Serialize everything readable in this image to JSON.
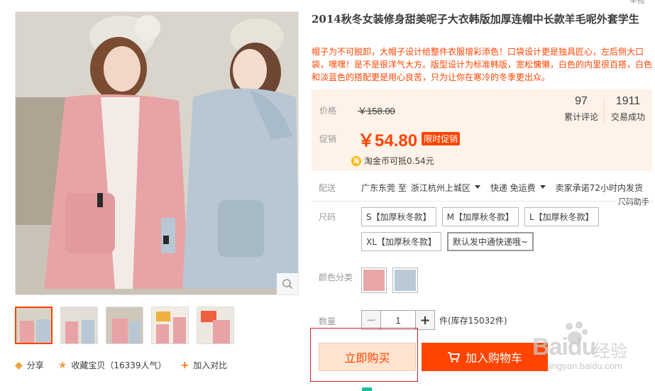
{
  "product": {
    "title": "2014秋冬女装修身甜美呢子大衣韩版加厚连帽中长款羊毛呢外套学生",
    "description": "帽子为不可脱卸，大帽子设计给整件衣服增彩添色！口袋设计更是独具匠心，左后侧大口袋，嘿嘿！是不是很洋气大方。版型设计为标准韩版，宽松慵懒，白色的内里很百搭，白色和淡蓝色的搭配更是用心良苦，只为让你在寒冷的冬季更出众。",
    "top_note": "举报"
  },
  "price": {
    "label_price": "价格",
    "original": "￥158.00",
    "label_promo": "促销",
    "current": "￥54.80",
    "promo_badge": "限时促销",
    "coin_icon": "淘",
    "coin_text": "淘金币可抵0.54元"
  },
  "stats": {
    "reviews_count": "97",
    "reviews_label": "累计评论",
    "sales_count": "1911",
    "sales_label": "交易成功"
  },
  "shipping": {
    "label": "配送",
    "from": "广东东莞 至",
    "to": "浙江杭州上城区",
    "method": "快递 免运费",
    "promise": "卖家承诺72小时内发货",
    "size_helper": "尺码助手"
  },
  "sizes": {
    "label": "尺码",
    "options": [
      "S【加厚秋冬款】",
      "M【加厚秋冬款】",
      "L【加厚秋冬款】",
      "XL【加厚秋冬款】",
      "默认发中通快递哦~"
    ]
  },
  "colors": {
    "label": "颜色分类",
    "swatches": [
      "#e8a6a6",
      "#b9c9d6"
    ]
  },
  "quantity": {
    "label": "数量",
    "minus": "−",
    "value": "1",
    "plus": "+",
    "stock": "件(库存15032件)"
  },
  "buttons": {
    "buy_now": "立即购买",
    "add_cart": "加入购物车"
  },
  "social": {
    "share": "分享",
    "favorite": "收藏宝贝（16339人气）",
    "compare": "加入对比"
  },
  "watermark": {
    "brand": "Baidu",
    "brand_cn": "经验",
    "url": "jingyan.baidu.com"
  },
  "colors_theme": {
    "accent": "#ff4400",
    "price_bg": "#fff2e8"
  }
}
